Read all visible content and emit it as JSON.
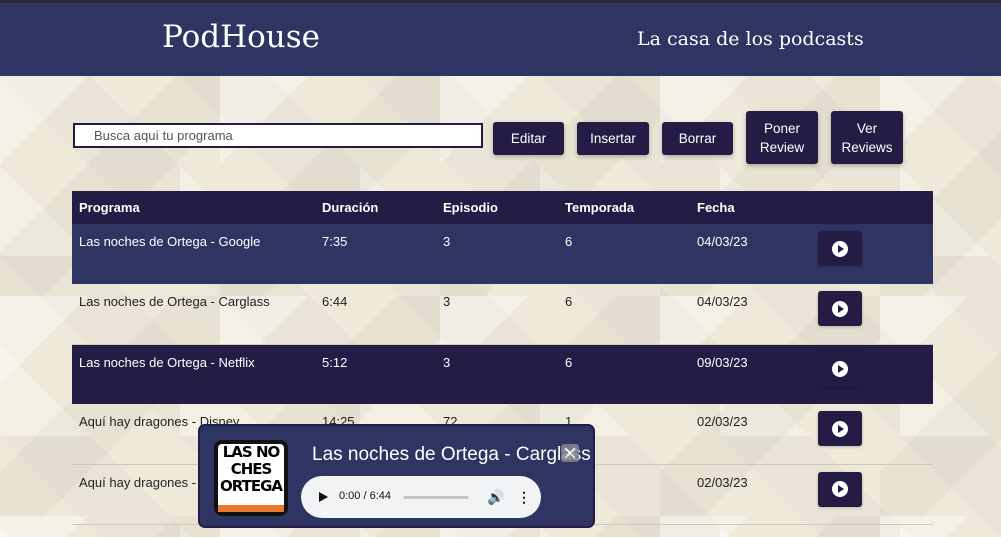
{
  "header": {
    "brand": "PodHouse",
    "tagline": "La casa de los podcasts"
  },
  "search": {
    "placeholder": "Busca aquí tu programa"
  },
  "actions": {
    "edit": "Editar",
    "insert": "Insertar",
    "delete": "Borrar",
    "review_line1": "Poner",
    "review_line2": "Review",
    "view_line1": "Ver",
    "view_line2": "Reviews"
  },
  "table": {
    "columns": [
      "Programa",
      "Duración",
      "Episodio",
      "Temporada",
      "Fecha"
    ],
    "rows": [
      {
        "program": "Las noches de Ortega - Google",
        "duration": "7:35",
        "episode": "3",
        "season": "6",
        "date": "04/03/23"
      },
      {
        "program": "Las noches de Ortega - Carglass",
        "duration": "6:44",
        "episode": "3",
        "season": "6",
        "date": "04/03/23"
      },
      {
        "program": "Las noches de Ortega - Netflix",
        "duration": "5:12",
        "episode": "3",
        "season": "6",
        "date": "09/03/23"
      },
      {
        "program": "Aquí hay dragones - Disney",
        "duration": "14:25",
        "episode": "72",
        "season": "1",
        "date": "02/03/23"
      },
      {
        "program": "Aquí hay dragones - I",
        "duration": "",
        "episode": "",
        "season": "",
        "date": "02/03/23"
      }
    ]
  },
  "player": {
    "title": "Las noches de Ortega - Carglass",
    "time": "0:00 / 6:44",
    "progress": 0,
    "cover_lines": [
      "LAS NO",
      "CHES",
      "ORTEGA"
    ]
  },
  "icons": {
    "play": "play-icon",
    "close": "close-icon",
    "volume": "volume-icon",
    "more": "more-vertical-icon"
  },
  "colors": {
    "header_bg": "#2e3563",
    "button_bg": "#241c45",
    "page_bg": "#efe9da",
    "cover_accent": "#e8772e"
  }
}
